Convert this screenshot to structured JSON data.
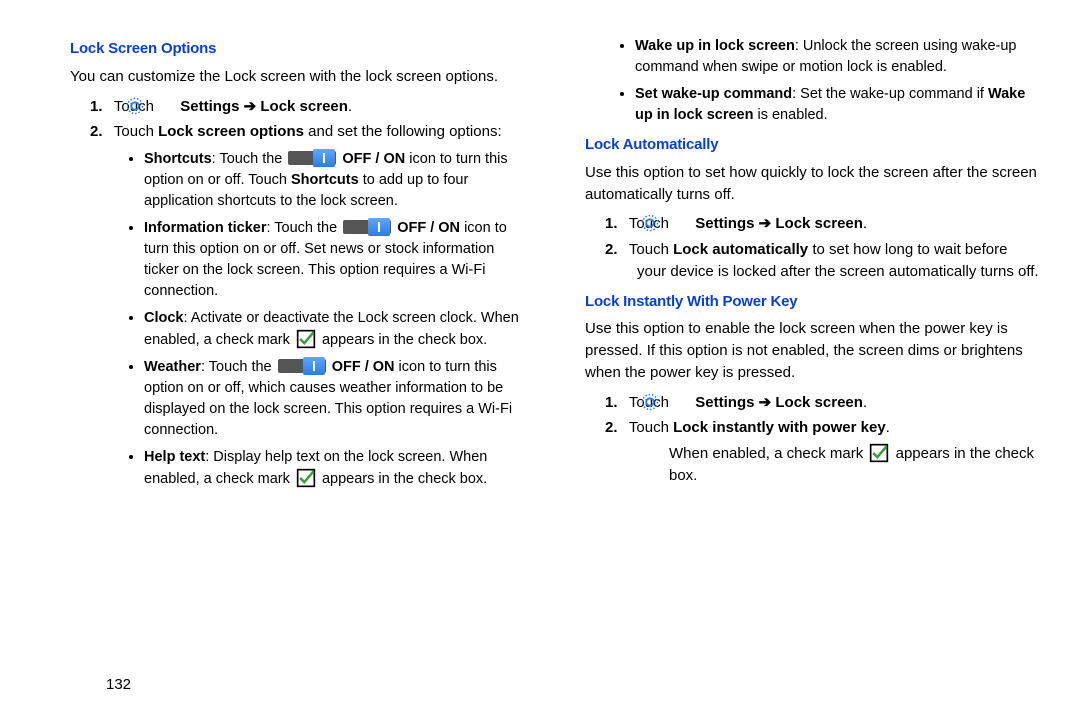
{
  "page_number": "132",
  "left": {
    "h1": "Lock Screen Options",
    "intro": "You can customize the Lock screen with the lock screen options.",
    "steps": [
      {
        "num": "1.",
        "prefix": "Touch ",
        "mid_bold": "Settings",
        "arrow": " ➔ ",
        "suffix_bold": "Lock screen",
        "tail": "."
      },
      {
        "num": "2.",
        "text_pre": "Touch ",
        "text_bold": "Lock screen options",
        "text_post": " and set the following options:"
      }
    ],
    "bullets": [
      {
        "lead": "Shortcuts",
        "pre": ": Touch the ",
        "icon": "toggle",
        "post": " ",
        "off_on": "OFF / ON",
        "rest": " icon to turn this option on or off. Touch ",
        "rest_bold": "Shortcuts",
        "rest2": " to add up to four application shortcuts to the lock screen."
      },
      {
        "lead": "Information ticker",
        "pre": ": Touch the ",
        "icon": "toggle",
        "off_on": "OFF / ON",
        "rest": " icon to turn this option on or off. Set news or stock information ticker on the lock screen. This option requires a Wi-Fi connection."
      },
      {
        "lead": "Clock",
        "full": ": Activate or deactivate the Lock screen clock. When enabled, a check mark ",
        "icon": "check",
        "tail": " appears in the check box."
      },
      {
        "lead": "Weather",
        "pre": ": Touch the ",
        "icon": "toggle",
        "off_on": "OFF / ON",
        "rest": " icon to turn this option on or off, which causes weather information to be displayed on the lock screen. This option requires a Wi-Fi connection."
      },
      {
        "lead": "Help text",
        "full": ": Display help text on the lock screen. When enabled, a check mark ",
        "icon": "check",
        "tail": " appears in the check box."
      }
    ]
  },
  "right": {
    "top_bullets": [
      {
        "lead": "Wake up in lock screen",
        "rest": ": Unlock the screen using wake-up command when swipe or motion lock is enabled."
      },
      {
        "lead": "Set wake-up command",
        "pre": ": Set the wake-up command if ",
        "bold": "Wake up in lock screen",
        "post": " is enabled."
      }
    ],
    "h2a": "Lock Automatically",
    "intro2a": "Use this option to set how quickly to lock the screen after the screen automatically turns off.",
    "steps2a": [
      {
        "num": "1.",
        "prefix": "Touch ",
        "mid_bold": "Settings",
        "arrow": " ➔ ",
        "suffix_bold": "Lock screen",
        "tail": "."
      },
      {
        "num": "2.",
        "text_pre": "Touch ",
        "text_bold": "Lock automatically",
        "text_post": " to set how long to wait before your device is locked after the screen automatically turns off."
      }
    ],
    "h2b": "Lock Instantly With Power Key",
    "intro2b": "Use this option to enable the lock screen when the power key is pressed. If this option is not enabled, the screen dims or brightens when the power key is pressed.",
    "steps2b": [
      {
        "num": "1.",
        "prefix": "Touch ",
        "mid_bold": "Settings",
        "arrow": " ➔ ",
        "suffix_bold": "Lock screen",
        "tail": "."
      },
      {
        "num": "2.",
        "text_pre": "Touch ",
        "text_bold": "Lock instantly with power key",
        "text_post": "."
      }
    ],
    "final": {
      "pre": "When enabled, a check mark ",
      "post": " appears in the check box."
    }
  }
}
